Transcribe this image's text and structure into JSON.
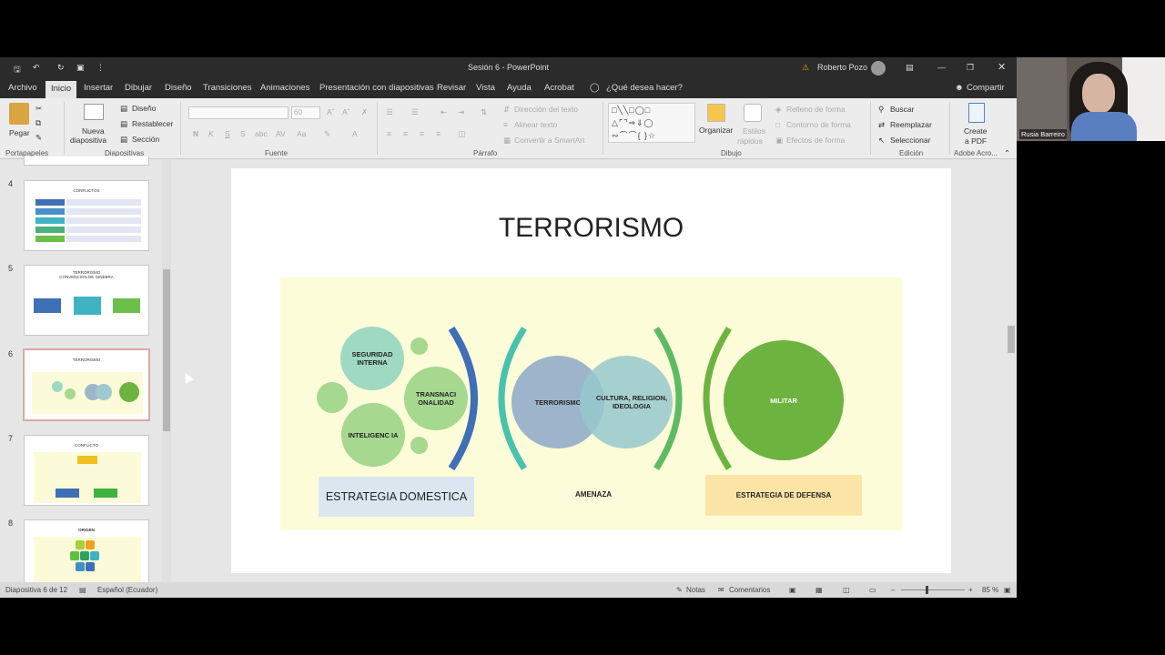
{
  "window": {
    "title": "Sesión 6  -  PowerPoint",
    "user": "Roberto Pozo"
  },
  "tabs": [
    "Archivo",
    "Inicio",
    "Insertar",
    "Dibujar",
    "Diseño",
    "Transiciones",
    "Animaciones",
    "Presentación con diapositivas",
    "Revisar",
    "Vista",
    "Ayuda",
    "Acrobat"
  ],
  "tell_me": "¿Qué desea hacer?",
  "share": "Compartir",
  "ribbon": {
    "paste": "Pegar",
    "new_slide_1": "Nueva",
    "new_slide_2": "diapositiva",
    "layout": "Diseño",
    "reset": "Restablecer",
    "section": "Sección",
    "font_size": "60",
    "text_direction": "Dirección del texto",
    "align_text": "Alinear texto",
    "smartart": "Convertir a SmartArt",
    "arrange": "Organizar",
    "quick_styles_1": "Estilos",
    "quick_styles_2": "rápidos",
    "shape_fill": "Relleno de forma",
    "shape_outline": "Contorno de forma",
    "shape_effects": "Efectos de forma",
    "find": "Buscar",
    "replace": "Reemplazar",
    "select": "Seleccionar",
    "create_pdf_1": "Create",
    "create_pdf_2": "a PDF",
    "groups": {
      "clipboard": "Portapapeles",
      "slides": "Diapositivas",
      "font": "Fuente",
      "paragraph": "Párrafo",
      "drawing": "Dibujo",
      "editing": "Edición",
      "adobe": "Adobe Acro..."
    }
  },
  "thumbnails": [
    {
      "num": "4",
      "title": "CONFLICTOS"
    },
    {
      "num": "5",
      "title": "TERRORISMO\nCONVENCION DE GINEBRA"
    },
    {
      "num": "6",
      "title": "TERRORISMO"
    },
    {
      "num": "7",
      "title": "CONFLICTO"
    },
    {
      "num": "8",
      "title": "ORIGEN"
    }
  ],
  "slide": {
    "title": "TERRORISMO",
    "circles": {
      "seguridad": "SEGURIDAD INTERNA",
      "transnacional": "TRANSNACI ONALIDAD",
      "inteligencia": "INTELIGENC IA",
      "terrorismo": "TERRORISMO",
      "cultura": "CULTURA, RELIGION, IDEOLOGIA",
      "militar": "MILITAR"
    },
    "labels": {
      "domestica": "ESTRATEGIA DOMESTICA",
      "amenaza": "AMENAZA",
      "defensa": "ESTRATEGIA DE DEFENSA"
    }
  },
  "status": {
    "slide_count": "Diapositiva 6 de 12",
    "language": "Español (Ecuador)",
    "notes": "Notas",
    "comments": "Comentarios",
    "zoom": "85 %"
  },
  "webcam": {
    "name": "Rusia Barreiro"
  }
}
